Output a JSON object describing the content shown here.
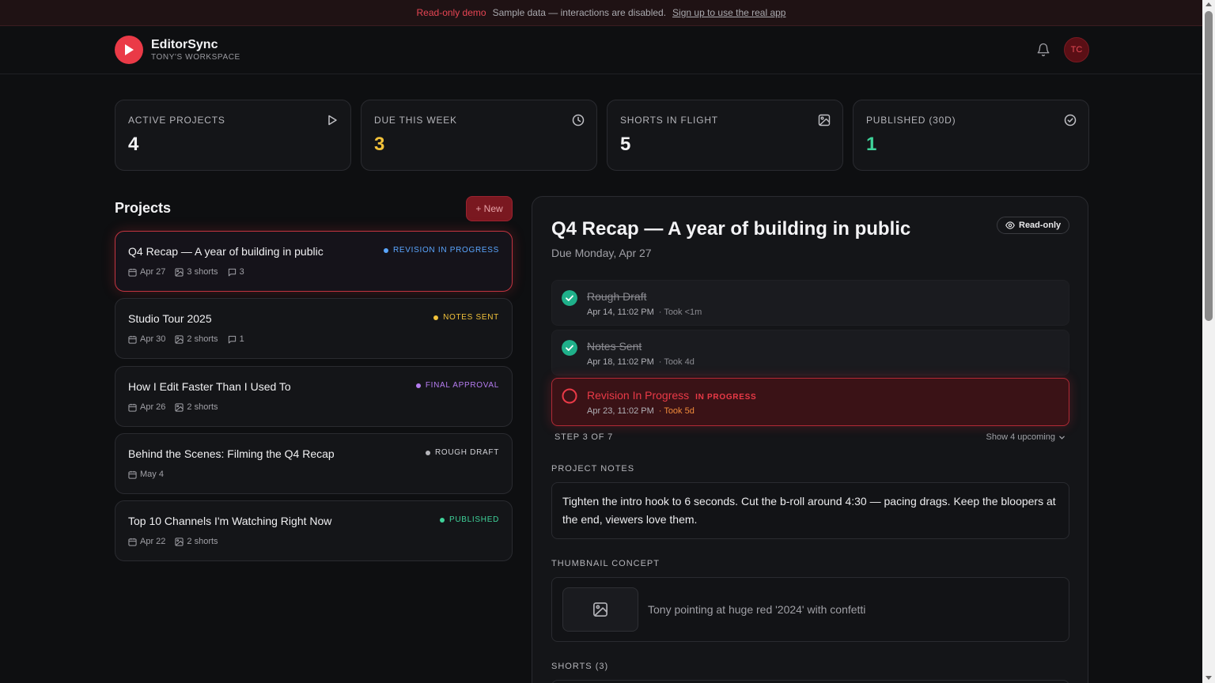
{
  "banner": {
    "readonly_label": "Read-only demo",
    "message": "Sample data — interactions are disabled.",
    "link": "Sign up to use the real app"
  },
  "header": {
    "app_name": "EditorSync",
    "workspace": "TONY'S WORKSPACE",
    "avatar_initials": "TC"
  },
  "stats": [
    {
      "label": "ACTIVE PROJECTS",
      "value": "4",
      "icon": "play-icon",
      "color": "#f3f3f5"
    },
    {
      "label": "DUE THIS WEEK",
      "value": "3",
      "icon": "clock-icon",
      "color": "#f2c23a"
    },
    {
      "label": "SHORTS IN FLIGHT",
      "value": "5",
      "icon": "image-icon",
      "color": "#f3f3f5"
    },
    {
      "label": "PUBLISHED (30D)",
      "value": "1",
      "icon": "check-circle-icon",
      "color": "#3fd39a"
    }
  ],
  "projects": {
    "title": "Projects",
    "new_label": "+ New",
    "items": [
      {
        "title": "Q4 Recap — A year of building in public",
        "status": "REVISION IN PROGRESS",
        "status_color": "#5aa6ff",
        "date": "Apr 27",
        "shorts": "3 shorts",
        "comments": "3"
      },
      {
        "title": "Studio Tour 2025",
        "status": "NOTES SENT",
        "status_color": "#f2c23a",
        "date": "Apr 30",
        "shorts": "2 shorts",
        "comments": "1"
      },
      {
        "title": "How I Edit Faster Than I Used To",
        "status": "FINAL APPROVAL",
        "status_color": "#b57cf0",
        "date": "Apr 26",
        "shorts": "2 shorts",
        "comments": ""
      },
      {
        "title": "Behind the Scenes: Filming the Q4 Recap",
        "status": "ROUGH DRAFT",
        "status_color": "#b5b5ba",
        "date": "May 4",
        "shorts": "",
        "comments": ""
      },
      {
        "title": "Top 10 Channels I'm Watching Right Now",
        "status": "PUBLISHED",
        "status_color": "#3fd39a",
        "date": "Apr 22",
        "shorts": "2 shorts",
        "comments": ""
      }
    ]
  },
  "detail": {
    "title": "Q4 Recap — A year of building in public",
    "due": "Due Monday, Apr 27",
    "readonly_pill": "Read-only",
    "steps": [
      {
        "name": "Rough Draft",
        "date": "Apr 14, 11:02 PM",
        "took": "· Took <1m"
      },
      {
        "name": "Notes Sent",
        "date": "Apr 18, 11:02 PM",
        "took": "· Took 4d"
      },
      {
        "name": "Revision In Progress",
        "badge": "IN PROGRESS",
        "date": "Apr 23, 11:02 PM",
        "took": "· Took 5d"
      }
    ],
    "step_count": "STEP 3 OF 7",
    "show_upcoming": "Show 4 upcoming",
    "notes_label": "PROJECT NOTES",
    "notes": "Tighten the intro hook to 6 seconds. Cut the b-roll around 4:30 — pacing drags. Keep the bloopers at the end, viewers love them.",
    "thumb_label": "THUMBNAIL CONCEPT",
    "thumb_text": "Tony pointing at huge red '2024' with confetti",
    "shorts_label": "SHORTS (3)"
  }
}
